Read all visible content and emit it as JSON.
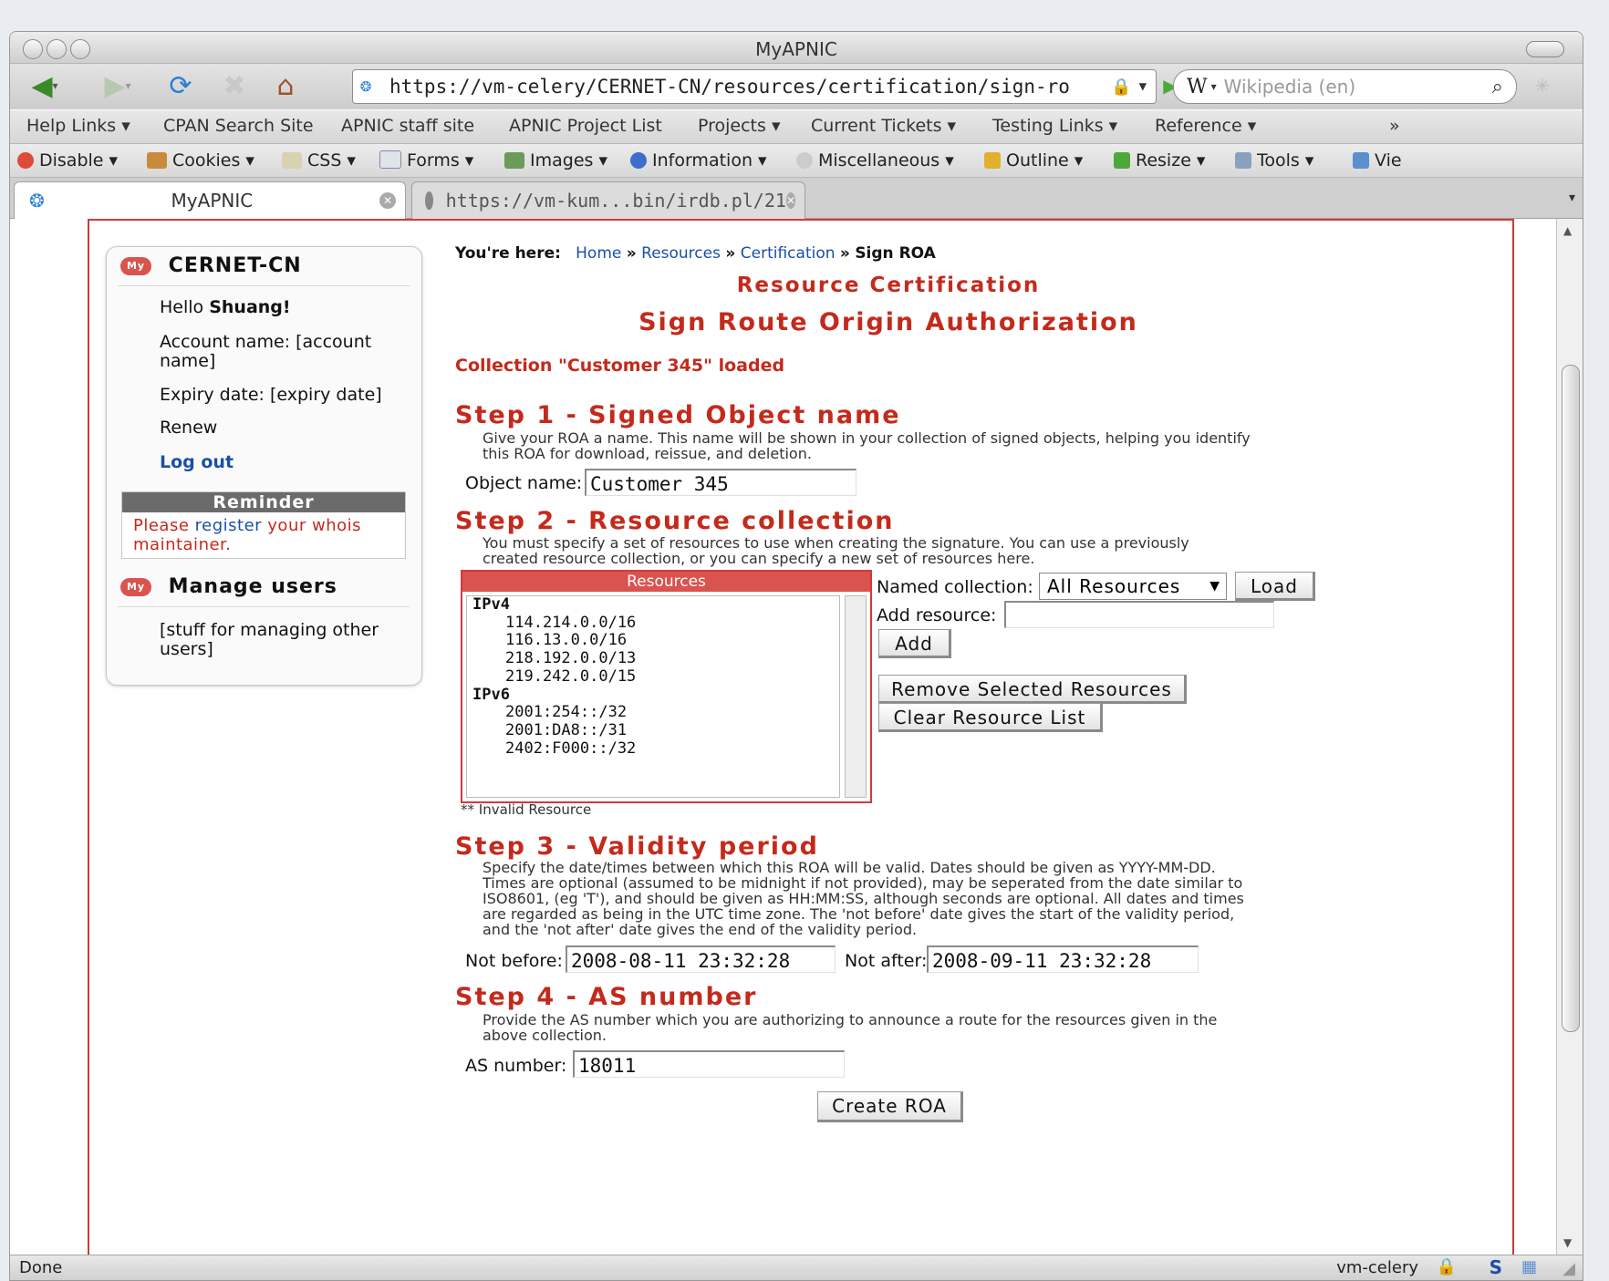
{
  "window": {
    "title": "MyAPNIC"
  },
  "nav": {
    "url": "https://vm-celery/CERNET-CN/resources/certification/sign-ro",
    "search_placeholder": "Wikipedia (en)",
    "search_engine_letter": "W"
  },
  "bookmarks": [
    "Help Links ▾",
    "CPAN Search Site",
    "APNIC staff site",
    "APNIC Project List",
    "Projects ▾",
    "Current Tickets ▾",
    "Testing Links ▾",
    "Reference ▾"
  ],
  "bookmarks_overflow": "»",
  "devbar": [
    "Disable ▾",
    "Cookies ▾",
    "CSS ▾",
    "Forms ▾",
    "Images ▾",
    "Information ▾",
    "Miscellaneous ▾",
    "Outline ▾",
    "Resize ▾",
    "Tools ▾",
    "Vie"
  ],
  "tabs": [
    {
      "label": "MyAPNIC"
    },
    {
      "label": "https://vm-kum...bin/irdb.pl/21"
    }
  ],
  "sidebar": {
    "org_heading": "CERNET-CN",
    "greeting_prefix": "Hello ",
    "greeting_name": "Shuang!",
    "account_line1": "Account name: [account",
    "account_line2": "name]",
    "expiry": "Expiry date: [expiry date]",
    "renew": "Renew",
    "logout": "Log out",
    "reminder_title": "Reminder",
    "reminder_pre": "Please ",
    "reminder_link": "register",
    "reminder_post": " your whois",
    "reminder_line2": "maintainer.",
    "manage_heading": "Manage users",
    "manage_line1": "[stuff for managing other",
    "manage_line2": "users]",
    "icon_label": "My"
  },
  "breadcrumb": {
    "prefix": "You're here:",
    "items": [
      "Home",
      "Resources",
      "Certification"
    ],
    "current": "Sign ROA",
    "sep": "»"
  },
  "main": {
    "title": "Resource Certification",
    "subtitle": "Sign Route Origin Authorization",
    "message": "Collection \"Customer 345\" loaded",
    "step1": {
      "heading": "Step 1 - Signed Object name",
      "desc1": "Give your ROA a name. This name will be shown in your collection of signed objects, helping you identify",
      "desc2": "this ROA for download, reissue, and deletion.",
      "label": "Object name:",
      "value": "Customer 345"
    },
    "step2": {
      "heading": "Step 2 - Resource collection",
      "desc1": "You must specify a set of resources to use when creating the signature. You can use a previously",
      "desc2": "created resource collection, or you can specify a new set of resources here.",
      "resources_header": "Resources",
      "ipv4_label": "IPv4",
      "ipv4": [
        "114.214.0.0/16",
        "116.13.0.0/16",
        "218.192.0.0/13",
        "219.242.0.0/15"
      ],
      "ipv6_label": "IPv6",
      "ipv6": [
        "2001:254::/32",
        "2001:DA8::/31",
        "2402:F000::/32"
      ],
      "invalid_note": "** Invalid Resource",
      "named_label": "Named collection:",
      "named_value": "All Resources",
      "load_button": "Load",
      "add_label": "Add resource:",
      "add_value": "",
      "add_button": "Add",
      "remove_button": "Remove Selected Resources",
      "clear_button": "Clear Resource List"
    },
    "step3": {
      "heading": "Step 3 - Validity period",
      "desc1": "Specify the date/times between which this ROA will be valid. Dates should be given as YYYY-MM-DD.",
      "desc2": "Times are optional (assumed to be midnight if not provided), may be seperated from the date similar to",
      "desc3": "ISO8601, (eg 'T'), and should be given as HH:MM:SS, although seconds are optional. All dates and times",
      "desc4": "are regarded as being in the UTC time zone. The 'not before' date gives the start of the validity period,",
      "desc5": "and the 'not after' date gives the end of the validity period.",
      "not_before_label": "Not before:",
      "not_before_value": "2008-08-11 23:32:28",
      "not_after_label": "Not after:",
      "not_after_value": "2008-09-11 23:32:28"
    },
    "step4": {
      "heading": "Step 4 - AS number",
      "desc1": "Provide the AS number which you are authorizing to announce a route for the resources given in the",
      "desc2": "above collection.",
      "label": "AS number:",
      "value": "18011"
    },
    "create_button": "Create ROA"
  },
  "status": {
    "left": "Done",
    "right": "vm-celery"
  },
  "colors": {
    "accent": "#c42a1c",
    "link": "#1a4fa8",
    "frame": "#d23a3a"
  }
}
